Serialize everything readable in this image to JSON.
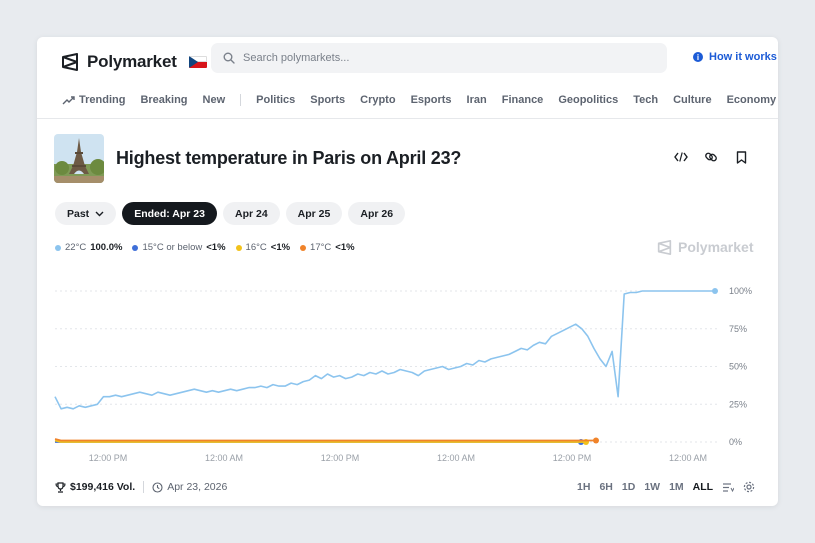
{
  "header": {
    "brand": "Polymarket",
    "search_placeholder": "Search polymarkets...",
    "how_it_works": "How it works"
  },
  "nav": {
    "trending": "Trending",
    "items": [
      "Breaking",
      "New",
      "Politics",
      "Sports",
      "Crypto",
      "Esports",
      "Iran",
      "Finance",
      "Geopolitics",
      "Tech",
      "Culture",
      "Economy"
    ]
  },
  "market": {
    "title": "Highest temperature in Paris on April 23?"
  },
  "dates": {
    "past_label": "Past",
    "pills": [
      "Ended: Apr 23",
      "Apr 24",
      "Apr 25",
      "Apr 26"
    ]
  },
  "legend": [
    {
      "label": "22°C",
      "value": "100.0%",
      "color": "#8cc4ee"
    },
    {
      "label": "15°C or below",
      "value": "<1%",
      "color": "#3f6fd8"
    },
    {
      "label": "16°C",
      "value": "<1%",
      "color": "#f2c21b"
    },
    {
      "label": "17°C",
      "value": "<1%",
      "color": "#f0832a"
    }
  ],
  "watermark": "Polymarket",
  "chart_data": {
    "type": "line",
    "y_ticks": [
      "100%",
      "75%",
      "50%",
      "25%",
      "0%"
    ],
    "x_ticks": [
      "12:00 PM",
      "12:00 AM",
      "12:00 PM",
      "12:00 AM",
      "12:00 PM",
      "12:00 AM"
    ],
    "ylim": [
      0,
      100
    ],
    "series": [
      {
        "name": "22°C",
        "color": "#8cc4ee",
        "values": [
          30,
          22,
          23,
          22,
          24,
          23,
          24,
          25,
          30,
          30,
          31,
          30,
          31,
          32,
          33,
          32,
          31,
          33,
          32,
          31,
          32,
          33,
          34,
          35,
          34,
          33,
          34,
          33,
          34,
          35,
          34,
          35,
          36,
          36,
          37,
          36,
          38,
          37,
          37,
          39,
          38,
          40,
          41,
          44,
          42,
          45,
          43,
          44,
          42,
          43,
          45,
          44,
          46,
          45,
          47,
          45,
          46,
          48,
          47,
          46,
          44,
          47,
          48,
          49,
          50,
          48,
          49,
          50,
          52,
          51,
          54,
          53,
          55,
          56,
          57,
          58,
          60,
          62,
          61,
          64,
          66,
          65,
          70,
          72,
          74,
          76,
          78,
          75,
          70,
          62,
          55,
          50,
          60,
          30,
          98,
          99,
          99,
          100,
          100,
          100,
          100,
          100,
          100,
          100,
          100,
          100,
          100,
          100,
          100,
          100
        ]
      },
      {
        "name": "15°C or below",
        "color": "#3f6fd8",
        "values": [
          0,
          0,
          0,
          0,
          0,
          0,
          0,
          0,
          0,
          0,
          0,
          0,
          0,
          0,
          0,
          0,
          0,
          0,
          0,
          0,
          0,
          0,
          0,
          0,
          0,
          0,
          0,
          0,
          0,
          0,
          0,
          0,
          0,
          0,
          0,
          0,
          0,
          0,
          0,
          0,
          0,
          0,
          0,
          0,
          0,
          0,
          0,
          0,
          0,
          0,
          0,
          0,
          0,
          0,
          0,
          0,
          0,
          0,
          0,
          0,
          0,
          0,
          0,
          0,
          0,
          0,
          0,
          0,
          0,
          0,
          0,
          0,
          0,
          0,
          0,
          0,
          0,
          0,
          0,
          0,
          0,
          0,
          0,
          0,
          0,
          0,
          0,
          0,
          0,
          0
        ]
      },
      {
        "name": "16°C",
        "color": "#f2c21b",
        "values": [
          1,
          0,
          0,
          0,
          0,
          0,
          0,
          0,
          0,
          0,
          0,
          0,
          0,
          0,
          0,
          0,
          0,
          0,
          0,
          0,
          0,
          0,
          0,
          0,
          0,
          0,
          0,
          0,
          0,
          0,
          0,
          0,
          0,
          0,
          0,
          0,
          0,
          0,
          0,
          0,
          0,
          0,
          0,
          0,
          0,
          0,
          0,
          0,
          0,
          0,
          0,
          0,
          0,
          0,
          0,
          0,
          0,
          0,
          0,
          0,
          0,
          0,
          0,
          0,
          0,
          0,
          0,
          0,
          0,
          0,
          0,
          0,
          0,
          0,
          0,
          0,
          0,
          0,
          0,
          0,
          0,
          0,
          0,
          0,
          0,
          0,
          0,
          0,
          0,
          0,
          0
        ]
      },
      {
        "name": "17°C",
        "color": "#f0832a",
        "values": [
          2,
          1,
          1,
          1,
          1,
          1,
          1,
          1,
          1,
          1,
          1,
          1,
          1,
          1,
          1,
          1,
          1,
          1,
          1,
          1,
          1,
          1,
          1,
          1,
          1,
          1,
          1,
          1,
          1,
          1,
          1,
          1,
          1,
          1,
          1,
          1,
          1,
          1,
          1,
          1,
          1,
          1,
          1,
          1,
          1,
          1,
          1,
          1,
          1,
          1,
          1,
          1,
          1,
          1,
          1,
          1,
          1,
          1,
          1,
          1,
          1,
          1,
          1,
          1,
          1,
          1,
          1,
          1,
          1,
          1,
          1,
          1,
          1,
          1,
          1,
          1,
          1,
          1,
          1,
          1,
          1,
          1,
          1,
          1,
          1,
          1,
          1,
          1,
          1,
          1,
          1,
          1
        ]
      }
    ]
  },
  "footer": {
    "volume": "$199,416 Vol.",
    "date": "Apr 23, 2026",
    "ranges": [
      "1H",
      "6H",
      "1D",
      "1W",
      "1M",
      "ALL"
    ],
    "active_range": "ALL"
  }
}
